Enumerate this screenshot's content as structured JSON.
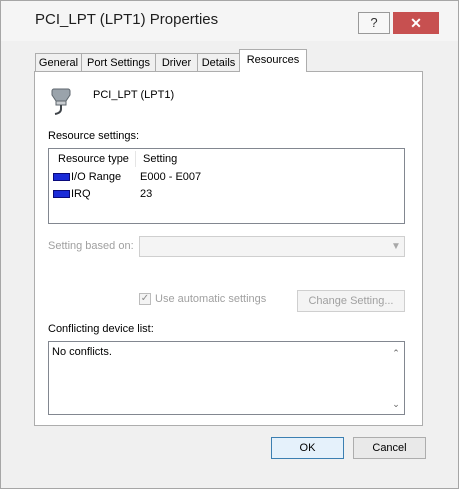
{
  "window": {
    "title": "PCI_LPT (LPT1) Properties",
    "help_label": "?",
    "close_label": "✕"
  },
  "tabs": [
    {
      "label": "General"
    },
    {
      "label": "Port Settings"
    },
    {
      "label": "Driver"
    },
    {
      "label": "Details"
    },
    {
      "label": "Resources",
      "active": true
    }
  ],
  "device": {
    "name": "PCI_LPT (LPT1)",
    "icon": "port-icon"
  },
  "resource_settings": {
    "label": "Resource settings:",
    "columns": [
      "Resource type",
      "Setting"
    ],
    "rows": [
      {
        "type": "I/O Range",
        "setting": "E000 - E007",
        "icon": "resource-chip-icon"
      },
      {
        "type": "IRQ",
        "setting": "23",
        "icon": "resource-chip-icon"
      }
    ]
  },
  "setting_based_on": {
    "label": "Setting based on:",
    "value": ""
  },
  "auto_settings": {
    "label": "Use automatic settings",
    "checked": true
  },
  "change_setting_label": "Change Setting...",
  "conflicts": {
    "label": "Conflicting device list:",
    "text": "No conflicts."
  },
  "buttons": {
    "ok": "OK",
    "cancel": "Cancel"
  }
}
